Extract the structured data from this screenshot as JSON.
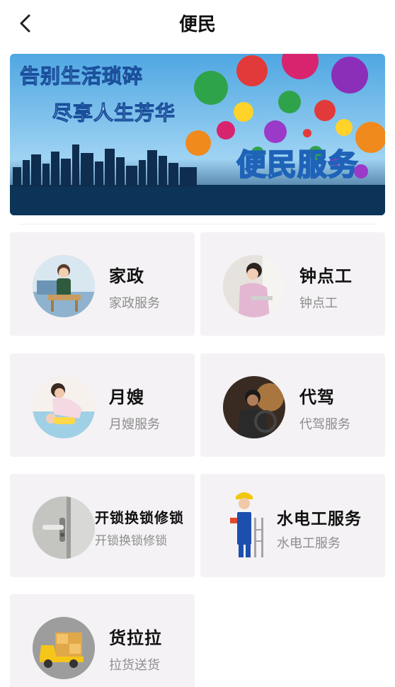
{
  "header": {
    "title": "便民",
    "back_icon": "chevron-left-icon"
  },
  "banner": {
    "line1": "告别生活琐碎",
    "line2": "尽享人生芳华",
    "headline": "便民服务"
  },
  "services": [
    {
      "name": "家政",
      "desc": "家政服务"
    },
    {
      "name": "钟点工",
      "desc": "钟点工"
    },
    {
      "name": "月嫂",
      "desc": "月嫂服务"
    },
    {
      "name": "代驾",
      "desc": "代驾服务"
    },
    {
      "name": "开锁换锁修锁",
      "desc": "开锁换锁修锁"
    },
    {
      "name": "水电工服务",
      "desc": "水电工服务"
    },
    {
      "name": "货拉拉",
      "desc": "拉货送货"
    }
  ]
}
